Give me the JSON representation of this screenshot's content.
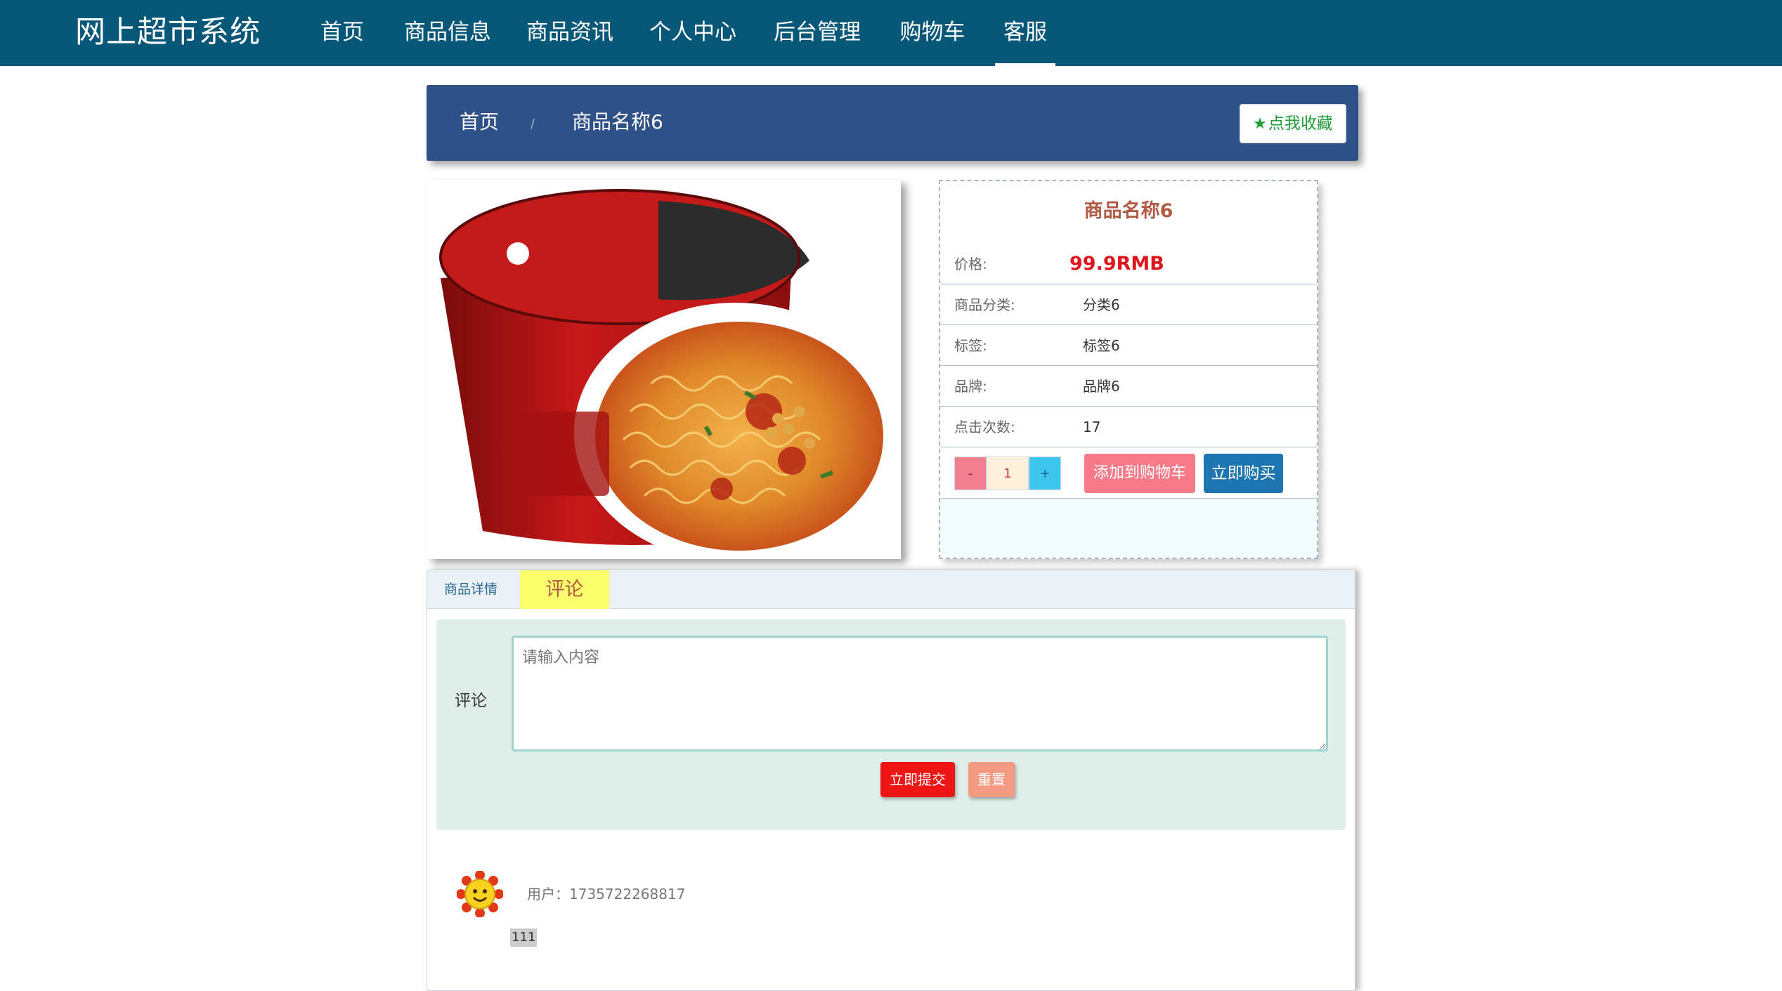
{
  "app": {
    "title": "网上超市系统"
  },
  "nav": {
    "items": [
      {
        "label": "首页"
      },
      {
        "label": "商品信息"
      },
      {
        "label": "商品资讯"
      },
      {
        "label": "个人中心"
      },
      {
        "label": "后台管理"
      },
      {
        "label": "购物车"
      },
      {
        "label": "客服",
        "active": true
      }
    ]
  },
  "breadcrumb": {
    "home": "首页",
    "separator": "/",
    "current": "商品名称6"
  },
  "favorite": {
    "label": "点我收藏",
    "icon": "star-icon",
    "color": "#1e9e35"
  },
  "product": {
    "name": "商品名称6",
    "image": "product-photo",
    "fields": [
      {
        "key": "价格:",
        "value": "99.9RMB"
      },
      {
        "key": "商品分类:",
        "value": "分类6"
      },
      {
        "key": "标签:",
        "value": "标签6"
      },
      {
        "key": "品牌:",
        "value": "品牌6"
      },
      {
        "key": "点击次数:",
        "value": "17"
      }
    ],
    "quantity": {
      "minus": "-",
      "value": "1",
      "plus": "+"
    },
    "add_to_cart": "添加到购物车",
    "buy_now": "立即购买"
  },
  "tabs": {
    "detail": "商品详情",
    "comment": "评论"
  },
  "comment_form": {
    "label": "评论",
    "placeholder": "请输入内容",
    "submit": "立即提交",
    "reset": "重置"
  },
  "comments": [
    {
      "user": "用户：1735722268817",
      "text": "111",
      "avatar": "smiley-avatar"
    }
  ],
  "colors": {
    "nav_bg": "#075779",
    "breadcrumb_bg": "#2e5287",
    "price": "#e0151c",
    "product_title": "#b15a44"
  }
}
